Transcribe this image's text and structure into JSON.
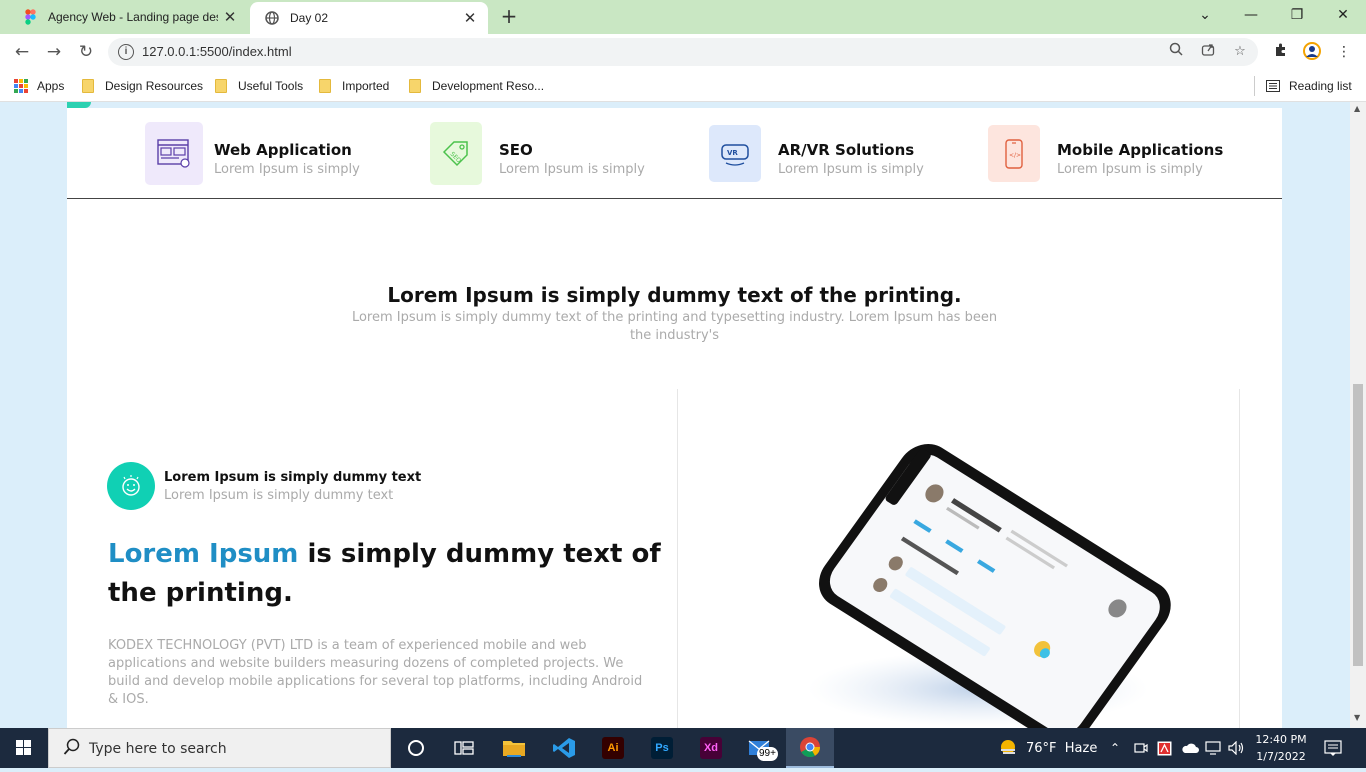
{
  "browser": {
    "tabs": [
      {
        "title": "Agency Web - Landing page desi",
        "close": "✕"
      },
      {
        "title": "Day 02",
        "close": "✕"
      }
    ],
    "new_tab": "+",
    "window_controls": {
      "minimize": "—",
      "restore": "❐",
      "close": "✕"
    },
    "url": "127.0.0.1:5500/index.html",
    "bookmarks": [
      {
        "label": "Apps"
      },
      {
        "label": "Design Resources"
      },
      {
        "label": "Useful Tools"
      },
      {
        "label": "Imported"
      },
      {
        "label": "Development Reso..."
      }
    ],
    "reading_list": "Reading list"
  },
  "services": [
    {
      "title": "Web Application",
      "subtitle": "Lorem Ipsum is simply",
      "bg": "#efe9fb",
      "color": "#5b3fa8"
    },
    {
      "title": "SEO",
      "subtitle": "Lorem Ipsum is simply",
      "bg": "#e7f9dc",
      "color": "#4cc24c"
    },
    {
      "title": "AR/VR Solutions",
      "subtitle": "Lorem Ipsum is simply",
      "bg": "#dde8fb",
      "color": "#1e4e9e"
    },
    {
      "title": "Mobile Applications",
      "subtitle": "Lorem Ipsum is simply",
      "bg": "#fde5de",
      "color": "#e0603e"
    }
  ],
  "section": {
    "heading": "Lorem Ipsum is simply dummy text of the printing.",
    "subheading": "Lorem Ipsum is simply dummy text of the printing and typesetting industry. Lorem Ipsum has been the industry's"
  },
  "feature": {
    "title": "Lorem Ipsum is simply dummy text",
    "subtitle": "Lorem Ipsum is simply dummy text",
    "heading_accent": "Lorem Ipsum",
    "heading_rest": " is simply dummy text of the printing.",
    "paragraph": "KODEX TECHNOLOGY (PVT) LTD is a team of experienced mobile and web applications and website builders measuring dozens of completed projects. We build and develop mobile applications for several top platforms, including Android & IOS."
  },
  "taskbar": {
    "search_placeholder": "Type here to search",
    "weather": "76°F  Haze",
    "time": "12:40 PM",
    "date": "1/7/2022",
    "mail_badge": "99+"
  },
  "colors": {
    "accent": "#1f8ec5",
    "teal": "#10d0b4"
  }
}
